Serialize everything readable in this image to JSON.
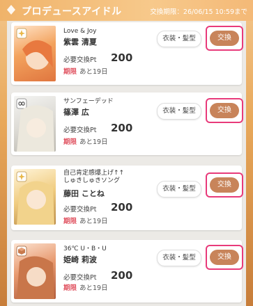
{
  "header": {
    "title": "プロデュースアイドル",
    "deadline": "交換期限：26/06/15 10:59まで"
  },
  "labels": {
    "required_pt": "必要交換Pt",
    "limit_key": "期限",
    "costume_button": "衣装・髪型",
    "exchange_button": "交換"
  },
  "colors": {
    "accent": "#e83a7a",
    "exchange_button": "#c8845a",
    "limit_text": "#e0515f"
  },
  "items": [
    {
      "card_name": "Love & Joy",
      "character": "紫雲 清夏",
      "pt": "200",
      "limit": "あと19日",
      "attr_icon": "sparkle-icon"
    },
    {
      "card_name": "サンフェーデッド",
      "character": "篠澤 広",
      "pt": "200",
      "limit": "あと19日",
      "attr_icon": "infinity-icon"
    },
    {
      "card_name": "自己肯定感爆上げ↑↑\nしゅきしゅきソング",
      "character": "藤田 ことね",
      "pt": "200",
      "limit": "あと19日",
      "attr_icon": "sparkle-icon"
    },
    {
      "card_name": "36℃ U・B・U",
      "character": "姫崎 莉波",
      "pt": "200",
      "limit": "あと19日",
      "attr_icon": "cube-icon"
    }
  ]
}
